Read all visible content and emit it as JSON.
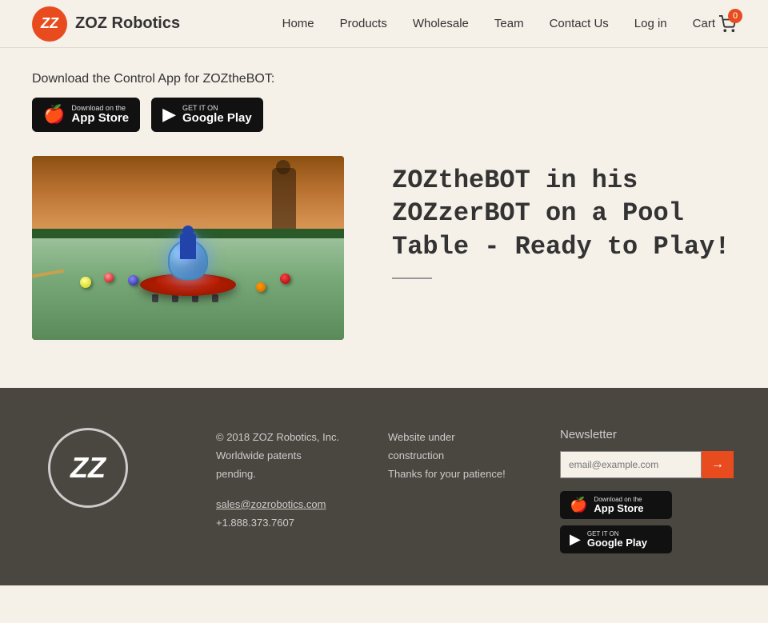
{
  "header": {
    "logo_text": "ZOZ Robotics",
    "logo_letters": "ZZ",
    "nav": {
      "home": "Home",
      "products": "Products",
      "wholesale": "Wholesale",
      "team": "Team",
      "contact": "Contact Us",
      "login": "Log in",
      "cart": "Cart",
      "cart_count": "0"
    }
  },
  "download": {
    "title": "Download the Control App for ZOZtheBOT:",
    "app_store_small": "Download on the",
    "app_store_large": "App Store",
    "google_play_small": "GET IT ON",
    "google_play_large": "Google Play"
  },
  "product": {
    "title": "ZOZtheBOT in his ZOZzerBOT on a Pool Table - Ready to Play!"
  },
  "footer": {
    "logo_letters": "ZZ",
    "copyright": "© 2018 ZOZ Robotics, Inc.",
    "patents": "Worldwide patents pending.",
    "email": "sales@zozrobotics.com",
    "phone": "+1.888.373.7607",
    "website_line1": "Website under construction",
    "website_line2": "Thanks for your patience!",
    "newsletter_title": "Newsletter",
    "newsletter_placeholder": "email@example.com",
    "app_store_small": "Download on the",
    "app_store_large": "App Store",
    "google_play_small": "GET IT ON",
    "google_play_large": "Google Play"
  }
}
